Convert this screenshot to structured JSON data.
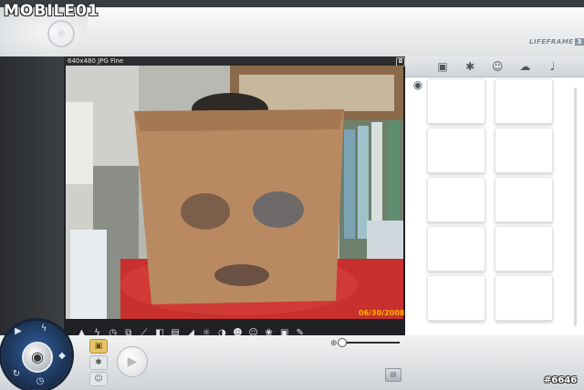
{
  "watermark": {
    "text": "MOBILE01"
  },
  "brand": {
    "name": "LIFEFRAME",
    "version": "3"
  },
  "video": {
    "resolution_label": "640x480 JPG Fine",
    "date_stamp": "06/30/2008"
  },
  "effects_toolbar": {
    "icons": [
      "landscape-icon",
      "flash-icon",
      "timer-icon",
      "multi-shot-icon",
      "ruler-icon",
      "frame-icon",
      "flip-icon",
      "corner-icon",
      "brightness-icon",
      "contrast-icon",
      "face-mask-icon",
      "emoticon-icon",
      "overlay-icon",
      "picture-in-picture-icon",
      "wrench-icon"
    ]
  },
  "side_tabs": [
    {
      "icon": "camera-icon",
      "glyph": "▣"
    },
    {
      "icon": "gear-icon",
      "glyph": "✱"
    },
    {
      "icon": "face-icon",
      "glyph": "☺"
    },
    {
      "icon": "cloud-icon",
      "glyph": "☁"
    },
    {
      "icon": "microphone-icon",
      "glyph": "♩"
    },
    {
      "icon": "eye-icon",
      "glyph": "◉"
    }
  ],
  "bottom": {
    "mode_buttons": [
      {
        "id": "photo",
        "glyph": "▣"
      },
      {
        "id": "settings",
        "glyph": "✱"
      },
      {
        "id": "face",
        "glyph": "☺"
      }
    ],
    "play_glyph": "▶",
    "zoom_glyph": "⊕",
    "gallery_glyph": "▤"
  },
  "post_id": "#6646",
  "colors": {
    "datestamp": "#ffb000",
    "dial_blue": "#2f5fa0",
    "active_mode": "#e8c46a"
  }
}
